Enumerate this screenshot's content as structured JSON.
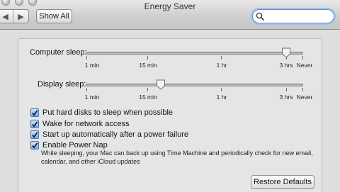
{
  "window": {
    "title": "Energy Saver"
  },
  "toolbar": {
    "back_glyph": "◀",
    "forward_glyph": "▶",
    "show_all_label": "Show All",
    "search": {
      "value": "",
      "placeholder": "",
      "icon": "search-icon"
    }
  },
  "computer_sleep": {
    "label": "Computer sleep:",
    "ticks": [
      "1 min",
      "15 min",
      "1 hr",
      "3 hrs",
      "Never"
    ],
    "value": "3 hrs"
  },
  "display_sleep": {
    "label": "Display sleep:",
    "ticks": [
      "1 min",
      "15 min",
      "1 hr",
      "3 hrs",
      "Never"
    ],
    "value": "15 min"
  },
  "options": [
    {
      "label": "Put hard disks to sleep when possible",
      "checked": true
    },
    {
      "label": "Wake for network access",
      "checked": true
    },
    {
      "label": "Start up automatically after a power failure",
      "checked": true
    },
    {
      "label": "Enable Power Nap",
      "checked": true
    }
  ],
  "power_nap_description": "While sleeping, your Mac can back up using Time Machine and periodically check for new email, calendar, and other iCloud updates",
  "restore_defaults_label": "Restore Defaults"
}
